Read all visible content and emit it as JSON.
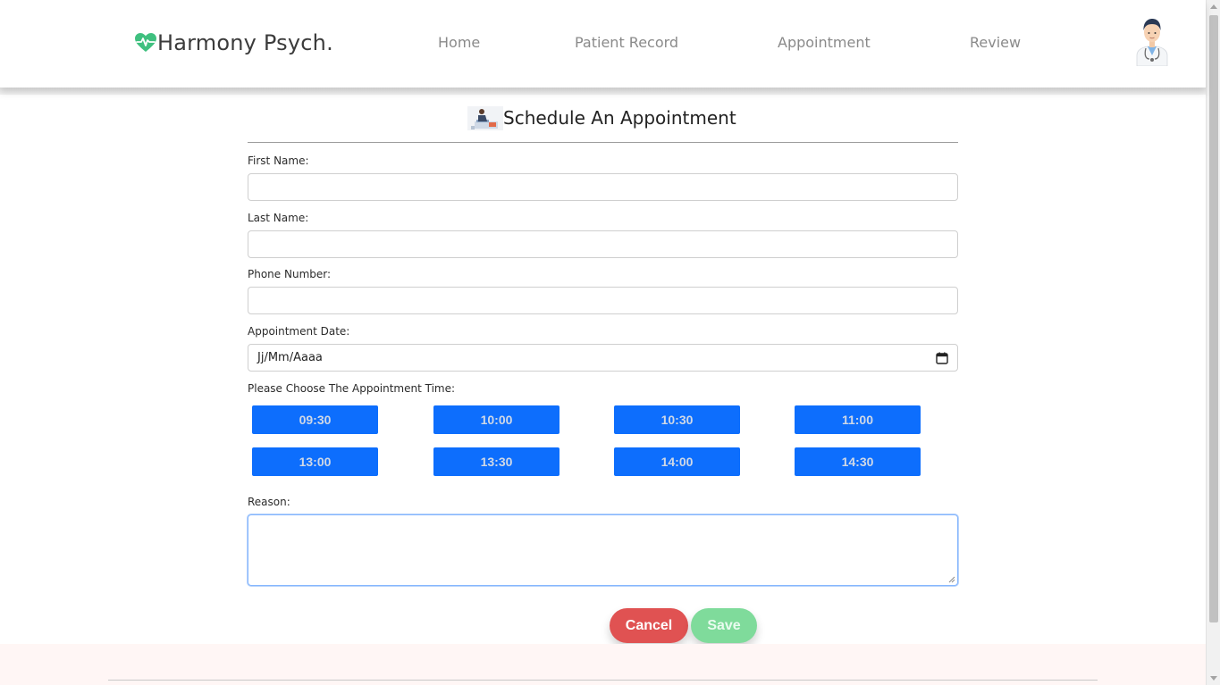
{
  "brand": {
    "name": "Harmony Psych.",
    "accent_color": "#3fc07f"
  },
  "nav": {
    "items": [
      {
        "label": "Home"
      },
      {
        "label": "Patient Record"
      },
      {
        "label": "Appointment"
      },
      {
        "label": "Review"
      }
    ]
  },
  "form": {
    "title": "Schedule An Appointment",
    "fields": {
      "first_name": {
        "label": "First Name:",
        "value": ""
      },
      "last_name": {
        "label": "Last Name:",
        "value": ""
      },
      "phone": {
        "label": "Phone Number:",
        "value": ""
      },
      "date": {
        "label": "Appointment Date:",
        "value": "Jj/Mm/Aaaa"
      },
      "reason": {
        "label": "Reason:",
        "value": ""
      }
    },
    "time_prompt": "Please Choose The Appointment Time:",
    "time_slots": [
      "09:30",
      "10:00",
      "10:30",
      "11:00",
      "13:00",
      "13:30",
      "14:00",
      "14:30"
    ],
    "time_slot_color": "#0d6efd",
    "buttons": {
      "cancel": "Cancel",
      "save": "Save"
    },
    "button_colors": {
      "cancel": "#e05252",
      "save": "#7fdb9b"
    }
  }
}
